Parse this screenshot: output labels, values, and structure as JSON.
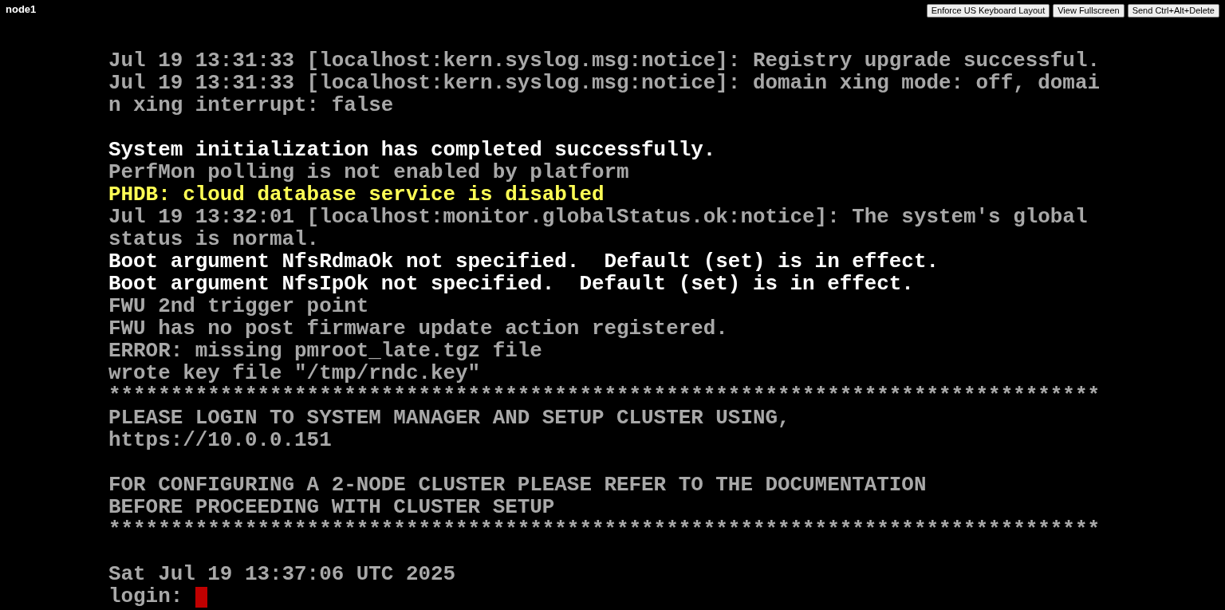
{
  "title": "node1",
  "buttons": [
    "Enforce US Keyboard Layout",
    "View Fullscreen",
    "Send Ctrl+Alt+Delete"
  ],
  "console_lines": [
    {
      "kind": "normal",
      "text": "Jul 19 13:31:33 [localhost:kern.syslog.msg:notice]: Registry upgrade successful."
    },
    {
      "kind": "normal",
      "text": "Jul 19 13:31:33 [localhost:kern.syslog.msg:notice]: domain xing mode: off, domai"
    },
    {
      "kind": "normal",
      "text": "n xing interrupt: false"
    },
    {
      "kind": "blank"
    },
    {
      "kind": "bright",
      "text": "System initialization has completed successfully."
    },
    {
      "kind": "normal",
      "text": "PerfMon polling is not enabled by platform"
    },
    {
      "kind": "warning",
      "text": "PHDB: cloud database service is disabled"
    },
    {
      "kind": "normal",
      "text": "Jul 19 13:32:01 [localhost:monitor.globalStatus.ok:notice]: The system's global"
    },
    {
      "kind": "normal",
      "text": "status is normal."
    },
    {
      "kind": "bright",
      "text": "Boot argument NfsRdmaOk not specified.  Default (set) is in effect."
    },
    {
      "kind": "bright",
      "text": "Boot argument NfsIpOk not specified.  Default (set) is in effect."
    },
    {
      "kind": "normal",
      "text": "FWU 2nd trigger point"
    },
    {
      "kind": "normal",
      "text": "FWU has no post firmware update action registered."
    },
    {
      "kind": "normal",
      "text": "ERROR: missing pmroot_late.tgz file"
    },
    {
      "kind": "normal",
      "text": "wrote key file \"/tmp/rndc.key\""
    },
    {
      "kind": "normal",
      "text": "********************************************************************************"
    },
    {
      "kind": "normal",
      "text": "PLEASE LOGIN TO SYSTEM MANAGER AND SETUP CLUSTER USING,"
    },
    {
      "kind": "normal",
      "text": "https://10.0.0.151"
    },
    {
      "kind": "blank"
    },
    {
      "kind": "normal",
      "text": "FOR CONFIGURING A 2-NODE CLUSTER PLEASE REFER TO THE DOCUMENTATION"
    },
    {
      "kind": "normal",
      "text": "BEFORE PROCEEDING WITH CLUSTER SETUP"
    },
    {
      "kind": "normal",
      "text": "********************************************************************************"
    },
    {
      "kind": "blank"
    },
    {
      "kind": "normal",
      "text": "Sat Jul 19 13:37:06 UTC 2025"
    }
  ],
  "prompt": {
    "text": "login: ",
    "cursor": true
  }
}
